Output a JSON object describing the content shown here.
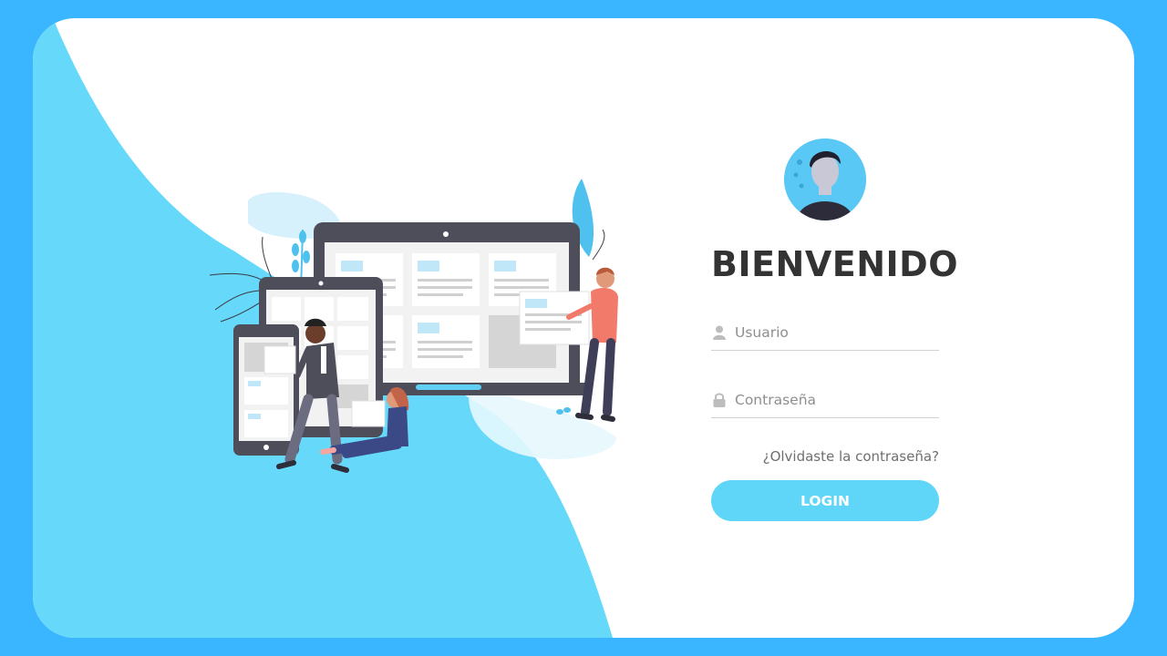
{
  "login": {
    "title": "BIENVENIDO",
    "username_placeholder": "Usuario",
    "password_placeholder": "Contraseña",
    "forgot_link": "¿Olvidaste la contraseña?",
    "button_label": "LOGIN"
  },
  "icons": {
    "avatar": "user-avatar-icon",
    "username": "user-icon",
    "password": "lock-icon"
  },
  "colors": {
    "outer_background": "#3ab5ff",
    "card_background": "#ffffff",
    "wave": "#66d9fb",
    "button": "#5fd6f7",
    "title_text": "#333333",
    "device_frame": "#555560"
  }
}
